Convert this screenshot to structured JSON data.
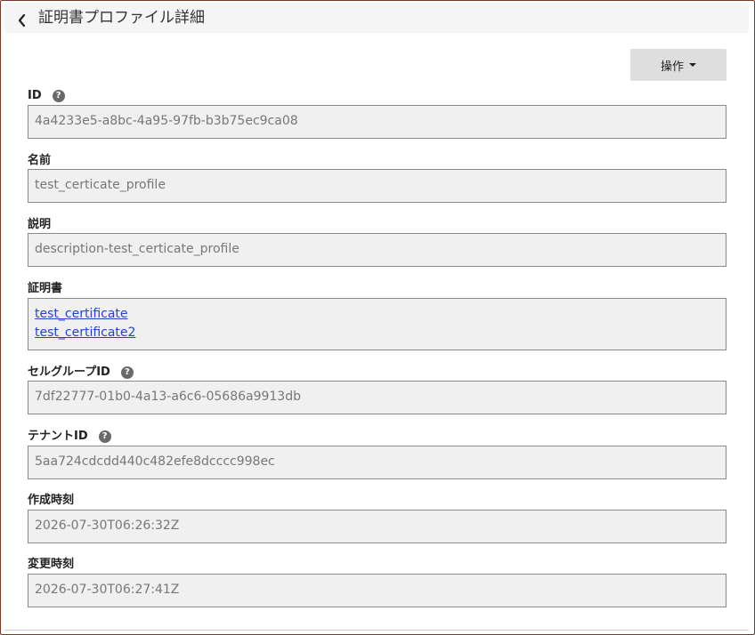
{
  "header": {
    "title": "証明書プロファイル詳細",
    "back_icon": "chevron-left-icon"
  },
  "actions": {
    "label": "操作"
  },
  "fields": {
    "id": {
      "label": "ID",
      "value": "4a4233e5-a8bc-4a95-97fb-b3b75ec9ca08",
      "help": "?"
    },
    "name": {
      "label": "名前",
      "value": "test_certicate_profile"
    },
    "description": {
      "label": "説明",
      "value": "description-test_certicate_profile"
    },
    "certificates": {
      "label": "証明書",
      "items": [
        "test_certificate",
        "test_certificate2"
      ]
    },
    "cell_group_id": {
      "label": "セルグループID",
      "value": "7df22777-01b0-4a13-a6c6-05686a9913db",
      "help": "?"
    },
    "tenant_id": {
      "label": "テナントID",
      "value": "5aa724cdcdd440c482efe8dcccc998ec",
      "help": "?"
    },
    "created_at": {
      "label": "作成時刻",
      "value": "2026-07-30T06:26:32Z"
    },
    "updated_at": {
      "label": "変更時刻",
      "value": "2026-07-30T06:27:41Z"
    }
  },
  "colors": {
    "frame_border": "#7a3a2a",
    "link": "#2244cc",
    "field_bg": "#f0f0f0",
    "button_bg": "#dedede"
  }
}
